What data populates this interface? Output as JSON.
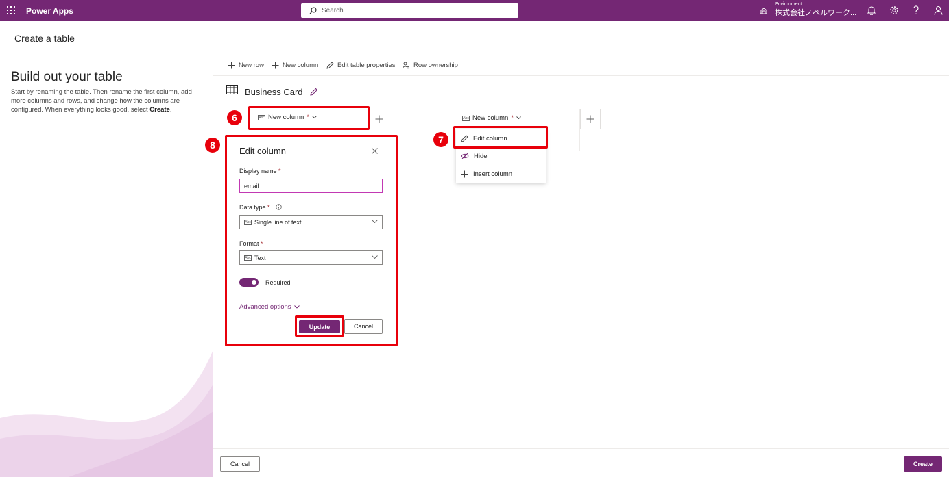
{
  "topbar": {
    "app_name": "Power Apps",
    "search_placeholder": "Search",
    "environment_label": "Environment",
    "environment_value": "株式会社ノベルワーク...",
    "bg_color": "#742774"
  },
  "page": {
    "title": "Create a table"
  },
  "left": {
    "heading": "Build out your table",
    "desc": "Start by renaming the table. Then rename the first column, add more columns and rows, and change how the columns are configured. When everything looks good, select ",
    "desc_bold": "Create",
    "desc_end": "."
  },
  "commands": {
    "new_row": "New row",
    "new_column": "New column",
    "edit_table_properties": "Edit table properties",
    "row_ownership": "Row ownership"
  },
  "table": {
    "name": "Business Card"
  },
  "columns": [
    {
      "label": "New column",
      "required_mark": "*"
    },
    {
      "label": "New column",
      "required_mark": "*"
    }
  ],
  "badges": {
    "six": "6",
    "seven": "7",
    "eight": "8"
  },
  "context_menu": {
    "edit_column": "Edit column",
    "hide": "Hide",
    "insert_column": "Insert column"
  },
  "edit_panel": {
    "title": "Edit column",
    "display_name_label": "Display name",
    "display_name_value": "email",
    "data_type_label": "Data type",
    "data_type_value": "Single line of text",
    "format_label": "Format",
    "format_value": "Text",
    "required_label": "Required",
    "required_on": true,
    "advanced_options": "Advanced options",
    "update_label": "Update",
    "cancel_label": "Cancel",
    "required_mark": "*"
  },
  "footer": {
    "cancel_label": "Cancel",
    "create_label": "Create"
  },
  "colors": {
    "accent": "#742774",
    "highlight": "#e8000b",
    "required": "#a4262c"
  }
}
